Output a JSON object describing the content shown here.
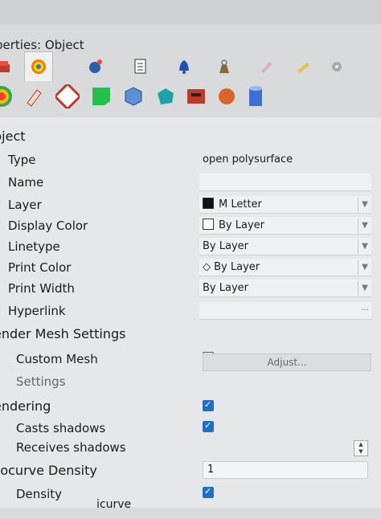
{
  "title": "perties: Object",
  "tabs": [
    {
      "icon": "layer-stack-icon"
    },
    {
      "icon": "material-sphere-icon"
    },
    {
      "icon": "light-bulb-icon"
    },
    {
      "icon": "page-icon"
    },
    {
      "icon": "bell-icon"
    },
    {
      "icon": "weight-icon"
    },
    {
      "icon": "pencil-icon"
    },
    {
      "icon": "ruler-icon"
    },
    {
      "icon": "gear-icon"
    }
  ],
  "materials": [
    "color-wheel-icon",
    "paint-tube-icon",
    "sphere-checker-icon",
    "green-square-icon",
    "blue-cube-icon",
    "teal-cube-icon",
    "red-box-icon",
    "orange-ball-icon",
    "blue-cylinder-icon"
  ],
  "section_object": "bject",
  "props": {
    "type_label": "Type",
    "type_value": "open polysurface",
    "name_label": "Name",
    "layer_label": "Layer",
    "layer_value": "M Letter",
    "display_color_label": "Display Color",
    "display_color_value": "By Layer",
    "linetype_label": "Linetype",
    "linetype_value": "By Layer",
    "print_color_label": "Print Color",
    "print_color_value": "By Layer",
    "print_width_label": "Print Width",
    "print_width_value": "By Layer",
    "hyperlink_label": "Hyperlink",
    "hyperlink_button": "..."
  },
  "render_mesh": {
    "section": "ender Mesh Settings",
    "custom_mesh_label": "Custom Mesh",
    "custom_mesh_checked": false,
    "settings_label": "Settings",
    "adjust_button": "Adjust..."
  },
  "rendering": {
    "section": "endering",
    "casts_label": "Casts shadows",
    "casts_checked": true,
    "receives_label": "Receives shadows",
    "receives_checked": true
  },
  "isocurve": {
    "section": "socurve Density",
    "value": "1",
    "density_label": "Density",
    "density_checked": true,
    "partial_label": "icurve"
  },
  "colors": {
    "accent": "#1f6fc5",
    "layer_swatch": "#111111"
  }
}
